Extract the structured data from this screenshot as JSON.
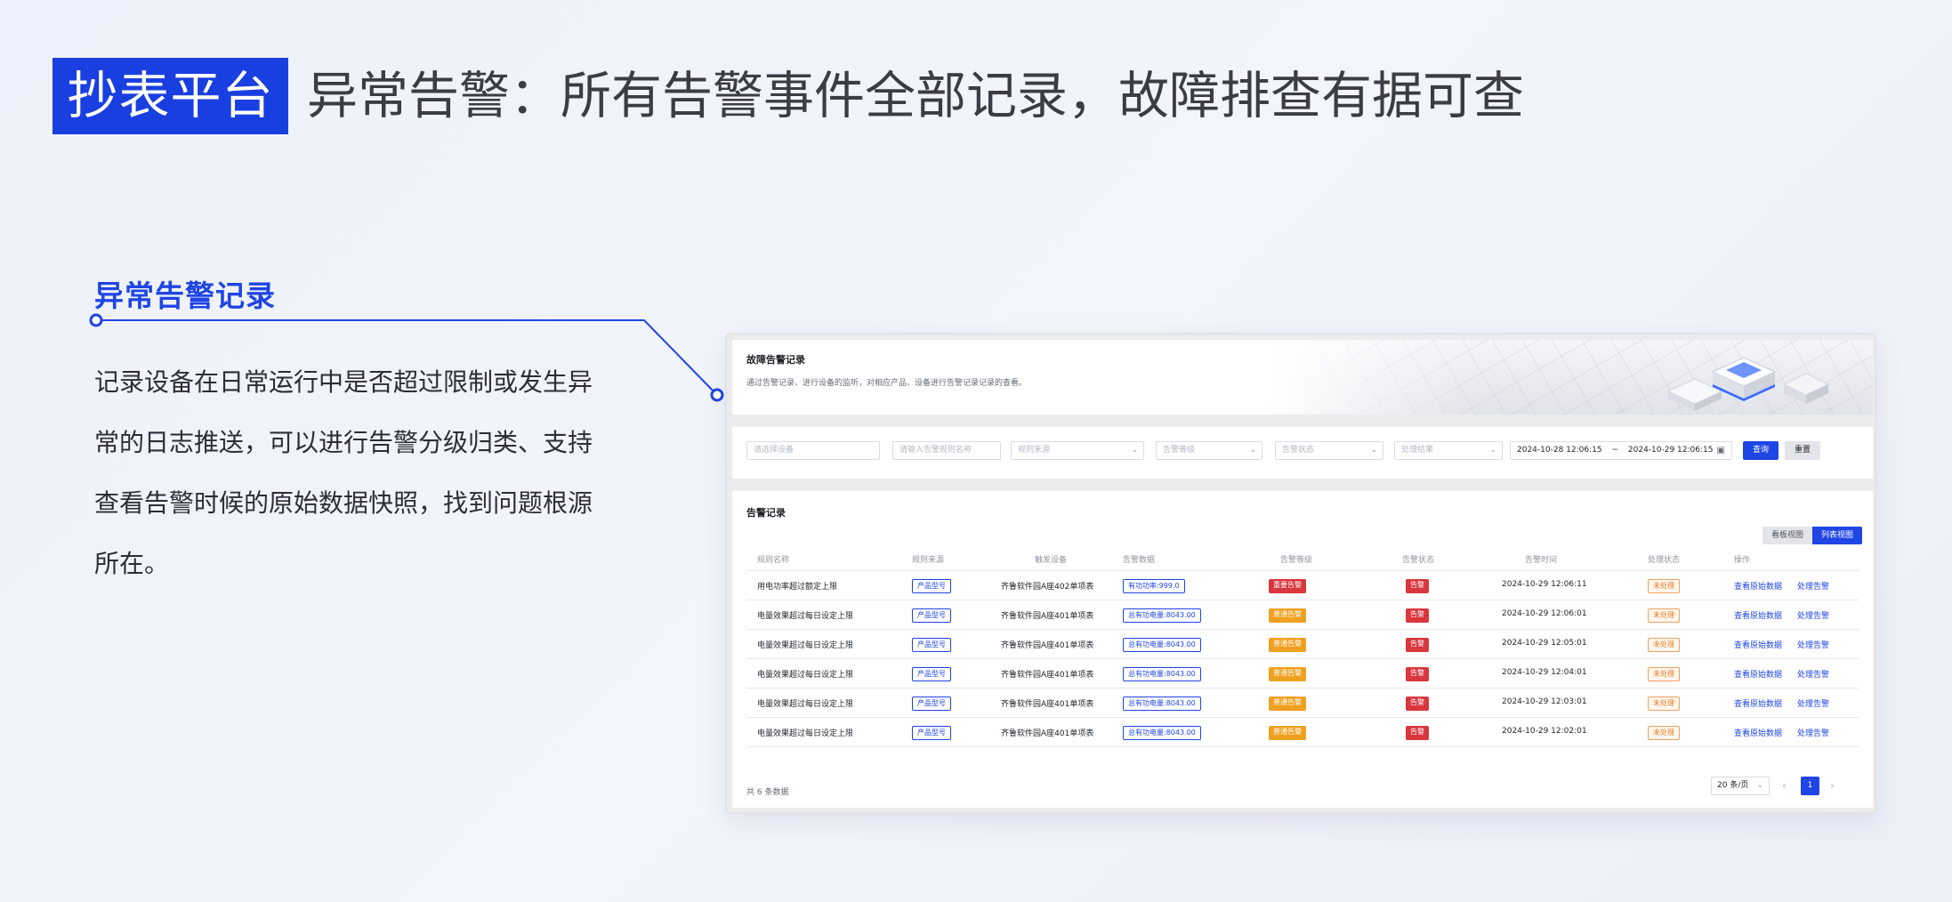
{
  "header": {
    "brand": "抄表平台",
    "headline": "异常告警：所有告警事件全部记录，故障排查有据可查"
  },
  "feature": {
    "title": "异常告警记录",
    "description": "记录设备在日常运行中是否超过限制或发生异常的日志推送，可以进行告警分级归类、支持查看告警时候的原始数据快照，找到问题根源所在。"
  },
  "banner": {
    "title": "故障告警记录",
    "subtitle": "通过告警记录、进行设备的监听，对相应产品、设备进行告警记录记录的查看。"
  },
  "filters": {
    "device_placeholder": "请选择设备",
    "rule_placeholder": "请输入告警规则名称",
    "rule_source_placeholder": "规则来源",
    "level_placeholder": "告警等级",
    "status_placeholder": "告警状态",
    "result_placeholder": "处理结果",
    "date_start": "2024-10-28 12:06:15",
    "date_sep": "~",
    "date_end": "2024-10-29 12:06:15",
    "query_label": "查询",
    "reset_label": "重置"
  },
  "table": {
    "title": "告警记录",
    "view_board": "看板视图",
    "view_list": "列表视图",
    "columns": [
      "规则名称",
      "规则来源",
      "触发设备",
      "告警数据",
      "告警等级",
      "告警状态",
      "告警时间",
      "处理状态",
      "操作"
    ],
    "rows": [
      {
        "name": "用电功率超过额定上限",
        "source": "产品型号",
        "device": "齐鲁软件园A座402单项表",
        "data": "有功功率:999.0",
        "level": "重要告警",
        "level_color": "#d9363e",
        "status": "告警",
        "time": "2024-10-29 12:06:11",
        "handle": "未处理",
        "op1": "查看原始数据",
        "op2": "处理告警"
      },
      {
        "name": "电量效果超过每日设定上限",
        "source": "产品型号",
        "device": "齐鲁软件园A座401单项表",
        "data": "总有功电量:8043.00",
        "level": "普通告警",
        "level_color": "#f0a020",
        "status": "告警",
        "time": "2024-10-29 12:06:01",
        "handle": "未处理",
        "op1": "查看原始数据",
        "op2": "处理告警"
      },
      {
        "name": "电量效果超过每日设定上限",
        "source": "产品型号",
        "device": "齐鲁软件园A座401单项表",
        "data": "总有功电量:8043.00",
        "level": "普通告警",
        "level_color": "#f0a020",
        "status": "告警",
        "time": "2024-10-29 12:05:01",
        "handle": "未处理",
        "op1": "查看原始数据",
        "op2": "处理告警"
      },
      {
        "name": "电量效果超过每日设定上限",
        "source": "产品型号",
        "device": "齐鲁软件园A座401单项表",
        "data": "总有功电量:8043.00",
        "level": "普通告警",
        "level_color": "#f0a020",
        "status": "告警",
        "time": "2024-10-29 12:04:01",
        "handle": "未处理",
        "op1": "查看原始数据",
        "op2": "处理告警"
      },
      {
        "name": "电量效果超过每日设定上限",
        "source": "产品型号",
        "device": "齐鲁软件园A座401单项表",
        "data": "总有功电量:8043.00",
        "level": "普通告警",
        "level_color": "#f0a020",
        "status": "告警",
        "time": "2024-10-29 12:03:01",
        "handle": "未处理",
        "op1": "查看原始数据",
        "op2": "处理告警"
      },
      {
        "name": "电量效果超过每日设定上限",
        "source": "产品型号",
        "device": "齐鲁软件园A座401单项表",
        "data": "总有功电量:8043.00",
        "level": "普通告警",
        "level_color": "#f0a020",
        "status": "告警",
        "time": "2024-10-29 12:02:01",
        "handle": "未处理",
        "op1": "查看原始数据",
        "op2": "处理告警"
      }
    ],
    "total": "共 6 条数据",
    "page_size": "20 条/页",
    "current_page": "1"
  },
  "icons": {
    "caret": "chevron-down-icon",
    "calendar": "calendar-icon",
    "prev": "chevron-left-icon",
    "next": "chevron-right-icon"
  },
  "colors": {
    "brand": "#1a3fe0",
    "primary": "#1f45e4",
    "danger": "#d9363e",
    "warning": "#f0a020"
  }
}
